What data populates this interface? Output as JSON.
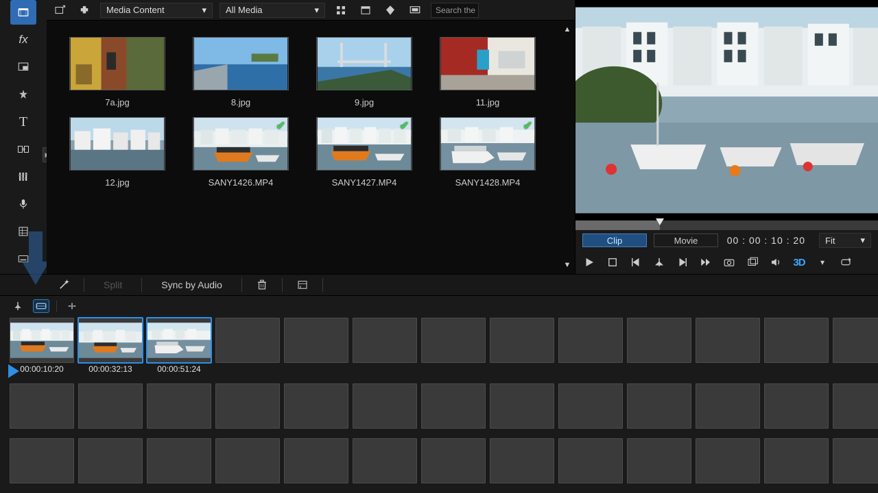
{
  "sidebar": {
    "tools": [
      {
        "name": "media-room-icon",
        "active": true
      },
      {
        "name": "fx-icon",
        "glyph": "fx"
      },
      {
        "name": "pip-icon"
      },
      {
        "name": "particle-icon"
      },
      {
        "name": "title-icon",
        "glyph": "T"
      },
      {
        "name": "transition-icon"
      },
      {
        "name": "audio-mix-icon"
      },
      {
        "name": "voice-icon"
      },
      {
        "name": "chapter-icon"
      },
      {
        "name": "subtitle-icon"
      }
    ]
  },
  "library_toolbar": {
    "import_icon": "import-media-icon",
    "plugin_icon": "plugin-icon",
    "dropdown1_label": "Media Content",
    "dropdown2_label": "All Media",
    "grid_icon": "grid-view-icon",
    "list_icon": "detail-view-icon",
    "tag_icon": "tag-icon",
    "display_icon": "display-icon",
    "search_placeholder": "Search the"
  },
  "media_items": [
    {
      "label": "7a.jpg",
      "kind": "street",
      "checked": false
    },
    {
      "label": "8.jpg",
      "kind": "sea",
      "checked": false
    },
    {
      "label": "9.jpg",
      "kind": "bridge",
      "checked": false
    },
    {
      "label": "11.jpg",
      "kind": "redhouse",
      "checked": false
    },
    {
      "label": "12.jpg",
      "kind": "town",
      "checked": false
    },
    {
      "label": "SANY1426.MP4",
      "kind": "harbor1",
      "checked": true
    },
    {
      "label": "SANY1427.MP4",
      "kind": "harbor2",
      "checked": true
    },
    {
      "label": "SANY1428.MP4",
      "kind": "harbor3",
      "checked": true
    }
  ],
  "preview": {
    "clip_label": "Clip",
    "movie_label": "Movie",
    "timecode": "00 : 00 : 10 : 20",
    "fit_label": "Fit",
    "threeD_label": "3D"
  },
  "mid_toolbar": {
    "wand_icon": "magic-wand-icon",
    "split_label": "Split",
    "sync_label": "Sync by Audio",
    "trash_icon": "trash-icon",
    "more_icon": "panel-icon"
  },
  "story_header_icons": [
    "marker-icon",
    "storyboard-icon",
    "divider",
    "snap-icon"
  ],
  "storyboard_clips": [
    {
      "time": "00:00:10:20",
      "kind": "harbor2",
      "selected": false
    },
    {
      "time": "00:00:32:13",
      "kind": "harbor1",
      "selected": true
    },
    {
      "time": "00:00:51:24",
      "kind": "harbor3",
      "selected": true
    }
  ],
  "empty_slots_row1": 10,
  "empty_slots_row2": 13,
  "empty_slots_row3": 13
}
